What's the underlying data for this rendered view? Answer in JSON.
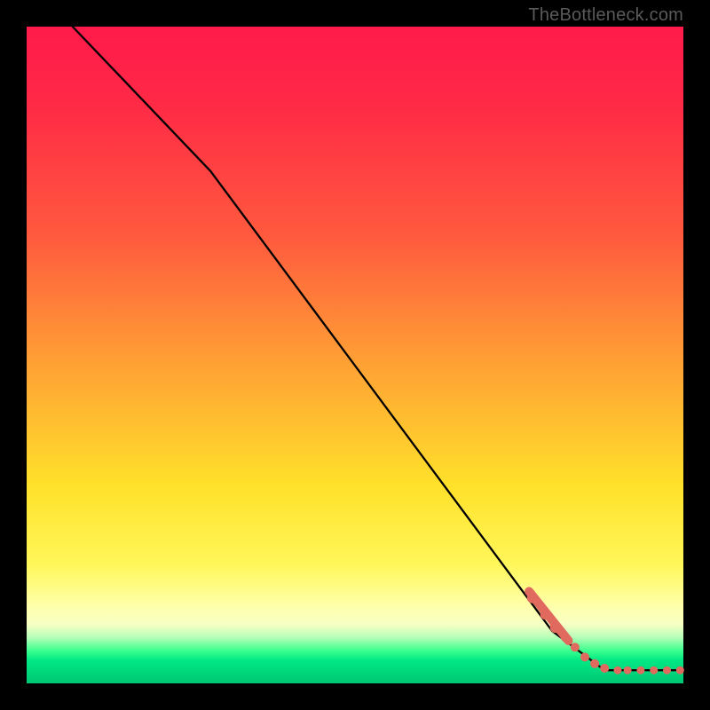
{
  "attribution": "TheBottleneck.com",
  "colors": {
    "background": "#000000",
    "gradient_stops": [
      "#ff1a4b",
      "#ff2a46",
      "#ff5a3e",
      "#ffa334",
      "#ffe12a",
      "#fff75a",
      "#ffffa8",
      "#f8ffc4",
      "#b6ffb8",
      "#3dff8e",
      "#00e884",
      "#00c674"
    ],
    "curve": "#000000",
    "marker": "#e06a5e"
  },
  "chart_data": {
    "type": "line",
    "title": "",
    "xlabel": "",
    "ylabel": "",
    "xlim": [
      0,
      100
    ],
    "ylim": [
      0,
      100
    ],
    "grid": false,
    "legend": false,
    "series": [
      {
        "name": "curve",
        "x": [
          7,
          28,
          80,
          88,
          100
        ],
        "y": [
          100,
          78,
          8,
          2,
          2
        ]
      }
    ],
    "marker_points": [
      {
        "x": 77,
        "y": 13,
        "r": 6
      },
      {
        "x": 79,
        "y": 10.5,
        "r": 6
      },
      {
        "x": 80.5,
        "y": 8.5,
        "r": 6
      },
      {
        "x": 82,
        "y": 7,
        "r": 5
      },
      {
        "x": 83.5,
        "y": 5.5,
        "r": 5
      },
      {
        "x": 85,
        "y": 4,
        "r": 5
      },
      {
        "x": 86.5,
        "y": 3,
        "r": 5
      },
      {
        "x": 88,
        "y": 2.3,
        "r": 5
      },
      {
        "x": 90,
        "y": 2,
        "r": 4.5
      },
      {
        "x": 91.5,
        "y": 2,
        "r": 4.5
      },
      {
        "x": 93.5,
        "y": 2,
        "r": 4.5
      },
      {
        "x": 95.5,
        "y": 2,
        "r": 4.5
      },
      {
        "x": 97.5,
        "y": 2,
        "r": 4.5
      },
      {
        "x": 99.5,
        "y": 2,
        "r": 4.5
      }
    ]
  }
}
